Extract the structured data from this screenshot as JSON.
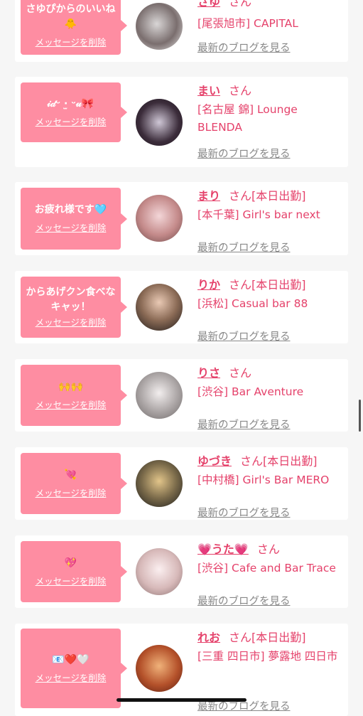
{
  "delete_label": "メッセージを削除",
  "blog_label": "最新のブログを見る",
  "san_label": "さん",
  "colors": {
    "bubble": "#fe8da2",
    "name": "#e5426b",
    "link": "#888888",
    "background": "#f6f6f6"
  },
  "cards": [
    {
      "message": "さゆぴからのいいね🐥",
      "name": "さゆ",
      "status": "",
      "shop": "[尾張旭市] CAPITAL"
    },
    {
      "message": "𝒾𝒹ᵕ ·̫ ᵕ𝓊🎀",
      "name": "まい",
      "status": "",
      "shop": "[名古屋 錦] Lounge BLENDA"
    },
    {
      "message": "お疲れ様です🩵",
      "name": "まり",
      "status": "[本日出勤]",
      "shop": "[本千葉] Girl's bar next"
    },
    {
      "message": "からあげクン食べなキャッ！",
      "name": "りか",
      "status": "[本日出勤]",
      "shop": "[浜松] Casual bar 88"
    },
    {
      "message": "🙌🙌",
      "name": "りさ",
      "status": "",
      "shop": "[渋谷] Bar Aventure"
    },
    {
      "message": "💘",
      "name": "ゆづき",
      "status": "[本日出勤]",
      "shop": "[中村橋] Girl's Bar MERO"
    },
    {
      "message": "💖",
      "name": "💗うた💗",
      "status": "",
      "shop": "[渋谷] Cafe and Bar Trace"
    },
    {
      "message": "📧❤️🤍",
      "name": "れお",
      "status": "[本日出勤]",
      "shop": "[三重 四日市] 夢露地 四日市"
    }
  ]
}
